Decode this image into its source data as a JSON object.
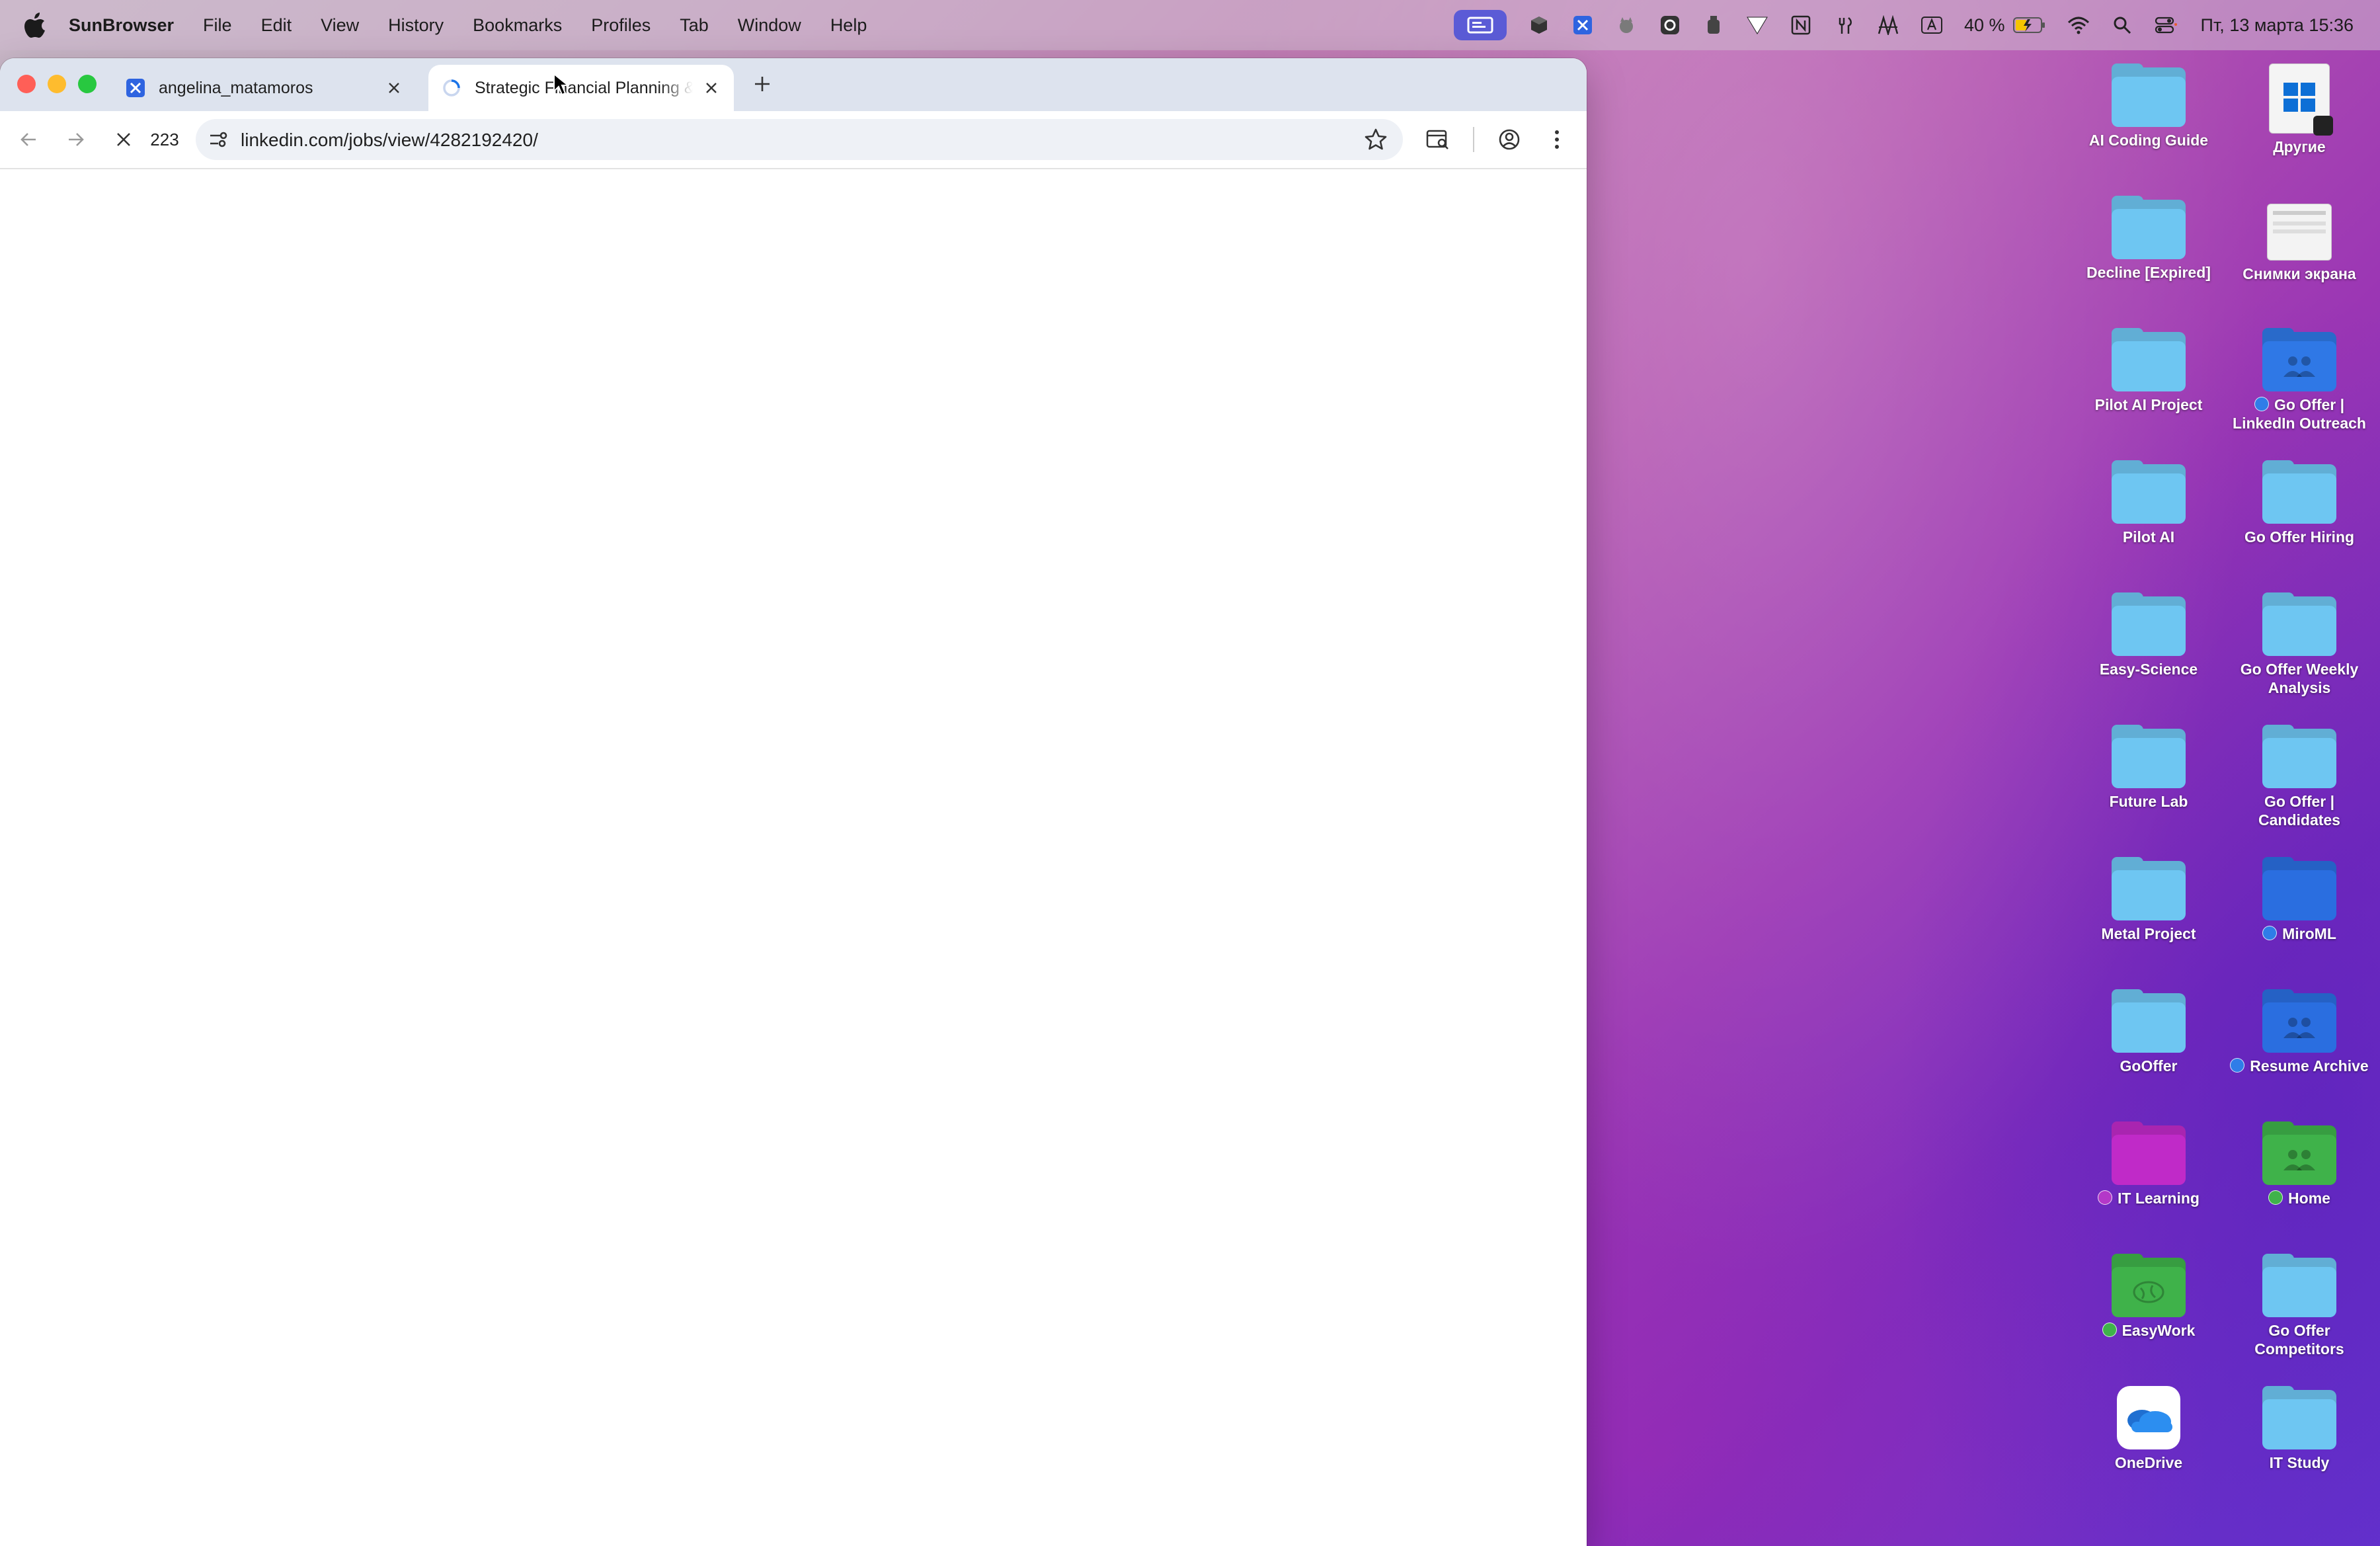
{
  "menubar": {
    "app_name": "SunBrowser",
    "items": [
      "File",
      "Edit",
      "View",
      "History",
      "Bookmarks",
      "Profiles",
      "Tab",
      "Window",
      "Help"
    ],
    "battery": "40 %",
    "datetime": "Пт, 13 марта  15:36",
    "status_icons": [
      "screen-share-icon",
      "cube-icon",
      "x-app-icon",
      "cat-icon",
      "circle-app-icon",
      "bottle-icon",
      "vpn-icon",
      "notion-icon",
      "fork-icon",
      "graph-icon",
      "keyboard-a-icon",
      "battery-icon",
      "wifi-icon",
      "search-icon",
      "control-center-icon"
    ]
  },
  "browser": {
    "tabs": [
      {
        "title": "angelina_matamoros",
        "active": false
      },
      {
        "title": "Strategic Financial Planning &",
        "active": true
      }
    ],
    "tab_counter": "223",
    "url": "linkedin.com/jobs/view/4282192420/"
  },
  "desktop": {
    "icons": [
      {
        "label": "AI Coding Guide",
        "kind": "folder",
        "color": "#6ec6f2"
      },
      {
        "label": "Другие",
        "kind": "doc"
      },
      {
        "label": "Decline [Expired]",
        "kind": "folder",
        "color": "#6ec6f2"
      },
      {
        "label": "Снимки экрана",
        "kind": "screenshot"
      },
      {
        "label": "Pilot AI Project",
        "kind": "folder",
        "color": "#6ec6f2"
      },
      {
        "label": "Go Offer | LinkedIn Outreach",
        "kind": "folder-shared",
        "color": "#2f78e6",
        "tag": "#2f7de8"
      },
      {
        "label": "Pilot AI",
        "kind": "folder",
        "color": "#6ec6f2"
      },
      {
        "label": "Go Offer Hiring",
        "kind": "folder",
        "color": "#6ec6f2"
      },
      {
        "label": "Easy-Science",
        "kind": "folder",
        "color": "#6ec6f2"
      },
      {
        "label": "Go Offer Weekly Analysis",
        "kind": "folder",
        "color": "#6ec6f2"
      },
      {
        "label": "Future Lab",
        "kind": "folder",
        "color": "#6ec6f2"
      },
      {
        "label": "Go Offer | Candidates",
        "kind": "folder",
        "color": "#6ec6f2"
      },
      {
        "label": "Metal Project",
        "kind": "folder",
        "color": "#6ec6f2"
      },
      {
        "label": "MiroML",
        "kind": "folder",
        "color": "#2a6ee0",
        "tag": "#2f7de8"
      },
      {
        "label": "GoOffer",
        "kind": "folder",
        "color": "#6ec6f2"
      },
      {
        "label": "Resume Archive",
        "kind": "folder-shared",
        "color": "#2a6ee0",
        "tag": "#2f7de8"
      },
      {
        "label": "IT Learning",
        "kind": "folder",
        "color": "#c02ac8",
        "tag": "#b438c8"
      },
      {
        "label": "Home",
        "kind": "folder-shared",
        "color": "#3fb24a",
        "tag": "#3fb24a"
      },
      {
        "label": "EasyWork",
        "kind": "folder-brain",
        "color": "#3fb24a",
        "tag": "#3fb24a"
      },
      {
        "label": "Go Offer Competitors",
        "kind": "folder",
        "color": "#6ec6f2"
      },
      {
        "label": "OneDrive",
        "kind": "onedrive"
      },
      {
        "label": "IT Study",
        "kind": "folder",
        "color": "#6ec6f2"
      }
    ]
  }
}
